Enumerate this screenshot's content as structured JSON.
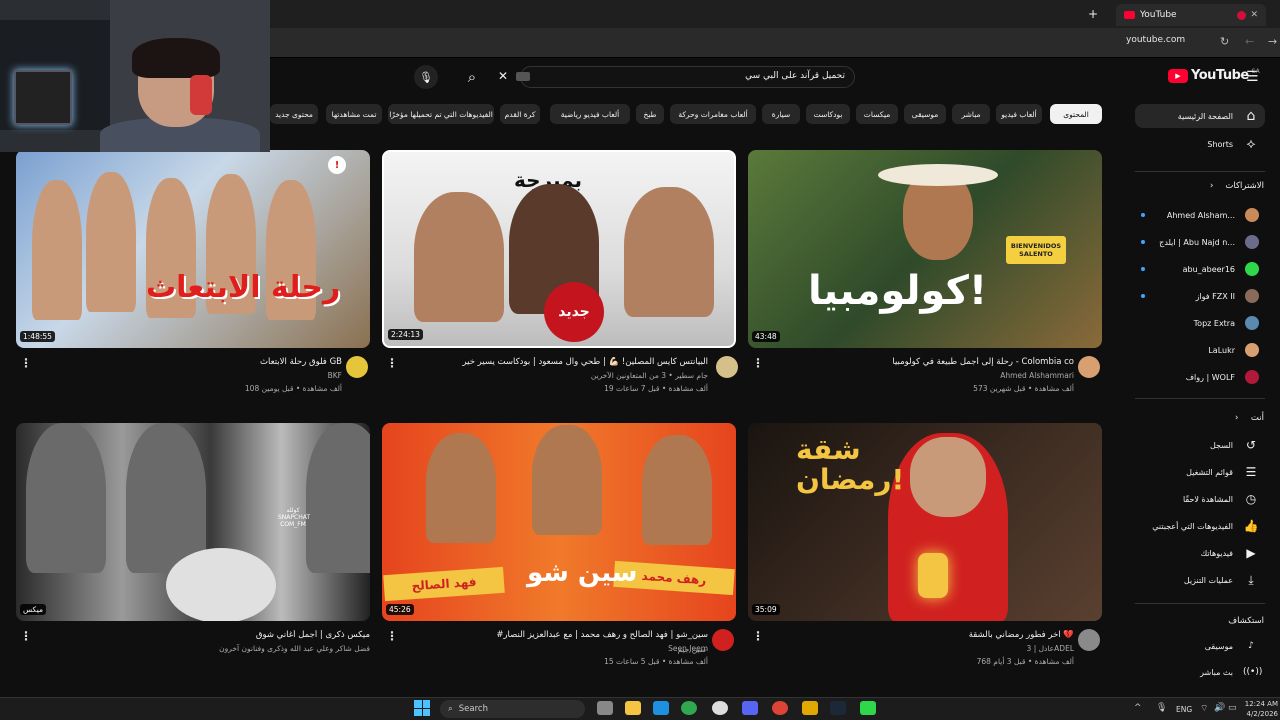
{
  "browser": {
    "tab_title": "YouTube",
    "new_tab": "+",
    "url": "youtube.com",
    "nav_icons": [
      "reload-icon",
      "back-icon",
      "forward-icon"
    ]
  },
  "header": {
    "logo": "YouTube",
    "logo_region": "SA",
    "search_query": "تحميل قرآند على البي سي",
    "clear": "✕",
    "search_icon": "⌕",
    "mic_icon": "🎙"
  },
  "chips": [
    "المحتوى",
    "ألعاب فيديو",
    "مباشر",
    "موسيقى",
    "ميكسات",
    "بودكاست",
    "سيارة",
    "ألعاب مغامرات وحركة",
    "طبخ",
    "ألعاب فيديو رياضية",
    "كرة القدم",
    "الفيديوهات التي تم تحميلها مؤخرًا",
    "تمت مشاهدتها",
    "محتوى جديد"
  ],
  "videos": [
    {
      "title": "رحلة إلى أجمل طبيعة في كولومبيا - Colombia co",
      "channel": "Ahmed Alshammari",
      "meta": "573 ألف مشاهدة • قبل شهرين",
      "duration": "43:48",
      "thumb_text": "كولومبيا!",
      "thumb_sign": "BIENVENIDOS SALENTO"
    },
    {
      "title": "البيانتس كايس المصلين! 💪🏻 | طحي وآل مسعود | بودكاست يسير خير",
      "channel": "جام سطير • 3 من المتعاونين الآخرين",
      "meta": "19 ألف مشاهدة • قبل 7 ساعات",
      "duration": "2:24:13",
      "thumb_text": "جديد",
      "thumb_logo": "بمبرجة"
    },
    {
      "title": "فلوق رحلة الابتعاث GB",
      "channel": "BKF",
      "meta": "108 ألف مشاهدة • قبل يومين",
      "duration": "1:48:55",
      "thumb_text": "رحلة الابتعاث",
      "thumb_badge": "!"
    },
    {
      "title": "اخر فطور رمضاني بالشقة 💔",
      "channel": "عادل | 3ADEL",
      "meta": "768 ألف مشاهدة • قبل 3 أيام",
      "duration": "35:09",
      "thumb_text": "شقة رمضان!"
    },
    {
      "title": "#سين_شو | فهد الصالح و رهف محمد | مع عبدالعزيز النصار",
      "channel": "Seen Jeem",
      "channel_sub": "سين جيم",
      "meta": "15 ألف مشاهدة • قبل 5 ساعات",
      "duration": "45:26",
      "thumb_text": "سين شو",
      "thumb_left": "فهد الصالح",
      "thumb_right": "رهف محمد"
    },
    {
      "title": "ميكس ذكرى | أجمل أغاني شوق",
      "channel": "فضل شاكر وعلي عبد الله وذكرى وفنانون آخرون",
      "meta": "",
      "duration": "ميكس",
      "thumb_watermark": "كولله SNAPCHAT COM_FM"
    }
  ],
  "sidebar": {
    "main": [
      {
        "label": "الصفحة الرئيسية",
        "icon": "home-icon"
      },
      {
        "label": "Shorts",
        "icon": "shorts-icon"
      }
    ],
    "subs_title": "الاشتراكات",
    "subs": [
      {
        "label": "Ahmed Alsham...",
        "color": "#c98a5a",
        "dot": true
      },
      {
        "label": "ايلدج | Abu Najd n...",
        "color": "#6b6b8c",
        "dot": true
      },
      {
        "label": "abu_abeer16",
        "color": "#2fd84b",
        "dot": true
      },
      {
        "label": "فواز FZX II",
        "color": "#8a6b5a",
        "dot": true
      },
      {
        "label": "Topz Extra",
        "color": "#5a8ab0",
        "dot": false
      },
      {
        "label": "LaLukr",
        "color": "#d8a070",
        "dot": false
      },
      {
        "label": "رواف | WOLF",
        "color": "#b01a3a",
        "dot": false
      }
    ],
    "you_title": "أنت",
    "you": [
      {
        "label": "السجل",
        "icon": "history-icon",
        "glyph": "↺"
      },
      {
        "label": "قوائم التشغيل",
        "icon": "playlist-icon",
        "glyph": "☰"
      },
      {
        "label": "المشاهدة لاحقًا",
        "icon": "clock-icon",
        "glyph": "◷"
      },
      {
        "label": "الفيديوهات التي أعجبتني",
        "icon": "like-icon",
        "glyph": "👍"
      },
      {
        "label": "فيديوهاتك",
        "icon": "video-icon",
        "glyph": "▶"
      },
      {
        "label": "عمليات التنزيل",
        "icon": "download-icon",
        "glyph": "⤓"
      }
    ],
    "explore_title": "استكشاف",
    "explore": [
      {
        "label": "موسيقى",
        "icon": "music-icon",
        "glyph": "♪"
      },
      {
        "label": "بث مباشر",
        "icon": "live-icon",
        "glyph": "((•))"
      }
    ]
  },
  "taskbar": {
    "search": "Search",
    "lang": "ENG",
    "time": "12:24 AM",
    "date": "4/2/2026"
  },
  "colors": {
    "accent": "#ff0033",
    "bg": "#0f0f0f",
    "chip": "#272727"
  }
}
